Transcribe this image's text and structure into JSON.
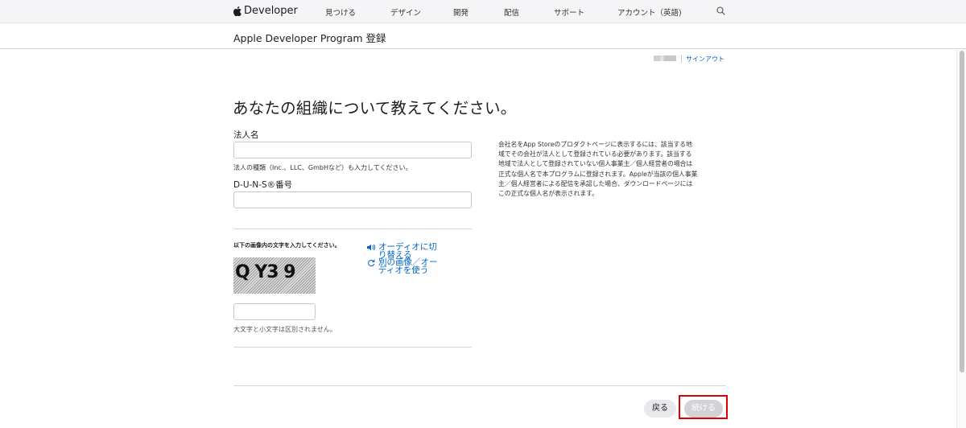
{
  "globalnav": {
    "brand": "Developer",
    "items": [
      "見つける",
      "デザイン",
      "開発",
      "配信",
      "サポート",
      "アカウント（英語)"
    ]
  },
  "subheader": {
    "title": "Apple Developer Program 登録"
  },
  "account": {
    "signout": "サインアウト"
  },
  "page": {
    "heading": "あなたの組織について教えてください。"
  },
  "form": {
    "legal_name_label": "法人名",
    "legal_name_value": "",
    "legal_name_hint": "法人の種類（Inc.、LLC、GmbHなど）も入力してください。",
    "duns_label": "D-U-N-S®番号",
    "duns_value": "",
    "captcha_prompt": "以下の画像内の文字を入力してください。",
    "captcha_image_text": "Q Y3 9",
    "audio_link": "オーディオに切り替える",
    "new_image_link": "別の画像／オーディオを使う",
    "captcha_value": "",
    "case_hint": "大文字と小文字は区別されません。"
  },
  "info": {
    "text": "会社名をApp Storeのプロダクトページに表示するには、該当する地域でその会社が法人として登録されている必要があります。該当する地域で法人として登録されていない個人事業主／個人経営者の場合は正式な個人名で本プログラムに登録されます。Appleが当該の個人事業主／個人経営者による配信を承認した場合、ダウンロードページにはこの正式な個人名が表示されます。"
  },
  "buttons": {
    "back": "戻る",
    "continue": "続ける"
  },
  "colors": {
    "link": "#0066cc",
    "highlight": "#e00000",
    "disabled_button": "#d2d2d7"
  }
}
